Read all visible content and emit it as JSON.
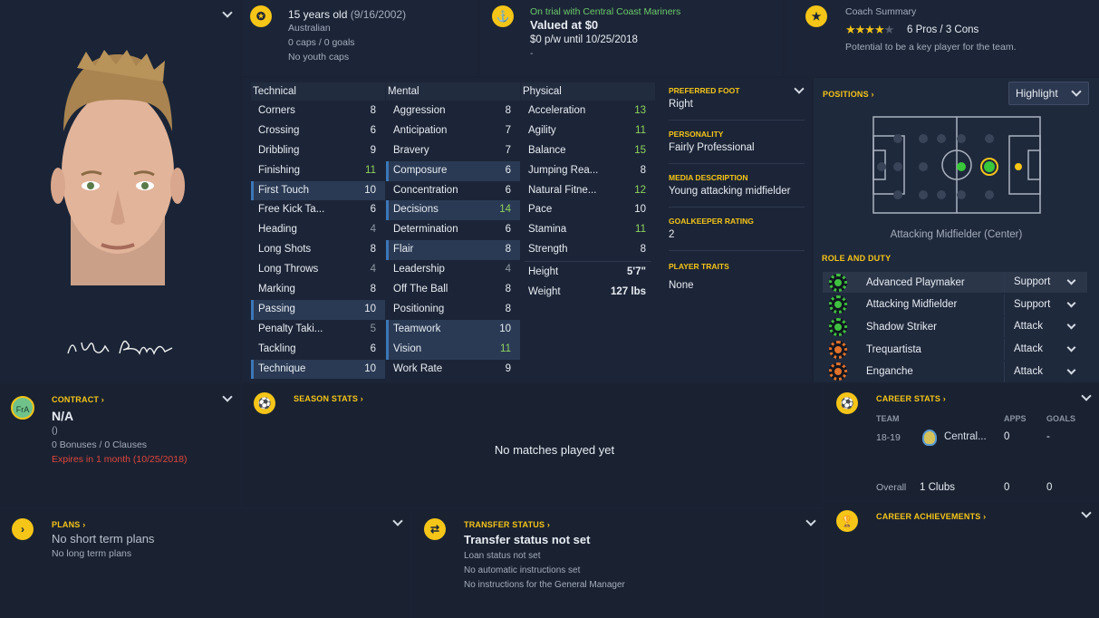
{
  "profile": {
    "age": "15 years old",
    "dob": "(9/16/2002)",
    "nationality": "Australian",
    "caps": "0 caps / 0 goals",
    "youth_caps": "No youth caps",
    "signature": "Ivia Bvn"
  },
  "value": {
    "trial": "On trial with Central Coast Mariners",
    "valued": "Valued at $0",
    "wage": "$0 p/w until 10/25/2018",
    "extra": "-"
  },
  "coach": {
    "title": "Coach Summary",
    "pros_cons": "6 Pros / 3 Cons",
    "potential": "Potential to be a key player for the team.",
    "stars": 3.5
  },
  "technical": {
    "header": "Technical",
    "rows": [
      {
        "name": "Corners",
        "value": "8"
      },
      {
        "name": "Crossing",
        "value": "6"
      },
      {
        "name": "Dribbling",
        "value": "9"
      },
      {
        "name": "Finishing",
        "value": "11"
      },
      {
        "name": "First Touch",
        "value": "10"
      },
      {
        "name": "Free Kick Ta...",
        "value": "6"
      },
      {
        "name": "Heading",
        "value": "4"
      },
      {
        "name": "Long Shots",
        "value": "8"
      },
      {
        "name": "Long Throws",
        "value": "4"
      },
      {
        "name": "Marking",
        "value": "8"
      },
      {
        "name": "Passing",
        "value": "10"
      },
      {
        "name": "Penalty Taki...",
        "value": "5"
      },
      {
        "name": "Tackling",
        "value": "6"
      },
      {
        "name": "Technique",
        "value": "10"
      }
    ]
  },
  "mental": {
    "header": "Mental",
    "rows": [
      {
        "name": "Aggression",
        "value": "8"
      },
      {
        "name": "Anticipation",
        "value": "7"
      },
      {
        "name": "Bravery",
        "value": "7"
      },
      {
        "name": "Composure",
        "value": "6"
      },
      {
        "name": "Concentration",
        "value": "6"
      },
      {
        "name": "Decisions",
        "value": "14"
      },
      {
        "name": "Determination",
        "value": "6"
      },
      {
        "name": "Flair",
        "value": "8"
      },
      {
        "name": "Leadership",
        "value": "4"
      },
      {
        "name": "Off The Ball",
        "value": "8"
      },
      {
        "name": "Positioning",
        "value": "8"
      },
      {
        "name": "Teamwork",
        "value": "10"
      },
      {
        "name": "Vision",
        "value": "11"
      },
      {
        "name": "Work Rate",
        "value": "9"
      }
    ]
  },
  "physical": {
    "header": "Physical",
    "rows": [
      {
        "name": "Acceleration",
        "value": "13"
      },
      {
        "name": "Agility",
        "value": "11"
      },
      {
        "name": "Balance",
        "value": "15"
      },
      {
        "name": "Jumping Rea...",
        "value": "8"
      },
      {
        "name": "Natural Fitne...",
        "value": "12"
      },
      {
        "name": "Pace",
        "value": "10"
      },
      {
        "name": "Stamina",
        "value": "11"
      },
      {
        "name": "Strength",
        "value": "8"
      }
    ],
    "height_label": "Height",
    "height": "5'7\"",
    "weight_label": "Weight",
    "weight": "127 lbs"
  },
  "info": {
    "foot_label": "Preferred Foot",
    "foot": "Right",
    "personality_label": "Personality",
    "personality": "Fairly Professional",
    "media_label": "Media Description",
    "media": "Young attacking midfielder",
    "gk_label": "Goalkeeper Rating",
    "gk": "2",
    "traits_label": "Player Traits",
    "traits": "None"
  },
  "positions": {
    "title": "Positions",
    "dropdown": "Highlight",
    "position_name": "Attacking Midfielder (Center)",
    "role_title": "Role and Duty",
    "roles": [
      {
        "name": "Advanced Playmaker",
        "duty": "Support",
        "color": "#3fbf3f"
      },
      {
        "name": "Attacking Midfielder",
        "duty": "Support",
        "color": "#3fbf3f"
      },
      {
        "name": "Shadow Striker",
        "duty": "Attack",
        "color": "#3fbf3f"
      },
      {
        "name": "Trequartista",
        "duty": "Attack",
        "color": "#e0702a"
      },
      {
        "name": "Enganche",
        "duty": "Attack",
        "color": "#e0702a"
      }
    ]
  },
  "contract": {
    "title": "Contract",
    "badge": "FrA",
    "value": "N/A",
    "paren": "()",
    "bonuses": "0 Bonuses / 0 Clauses",
    "expires": "Expires in 1 month",
    "expires_date": "(10/25/2018)"
  },
  "season_stats": {
    "title": "Season Stats",
    "empty": "No matches played yet"
  },
  "career_stats": {
    "title": "Career Stats",
    "col_team": "TEAM",
    "col_apps": "APPS",
    "col_goals": "GOALS",
    "rows": [
      {
        "season": "18-19",
        "club": "Central...",
        "apps": "0",
        "goals": "-"
      }
    ],
    "overall_label": "Overall",
    "overall_clubs": "1 Clubs",
    "overall_apps": "0",
    "overall_goals": "0"
  },
  "plans": {
    "title": "Plans",
    "short": "No short term plans",
    "long": "No long term plans"
  },
  "transfer": {
    "title": "Transfer Status",
    "status": "Transfer status not set",
    "loan": "Loan status not set",
    "auto": "No automatic instructions set",
    "gm": "No instructions for the General Manager"
  },
  "achievements": {
    "title": "Career Achievements"
  },
  "colors": {
    "accent": "#f5c518",
    "good": "#8fd45d",
    "highlight_row": "#2a3a54",
    "expires": "#e0453a"
  }
}
